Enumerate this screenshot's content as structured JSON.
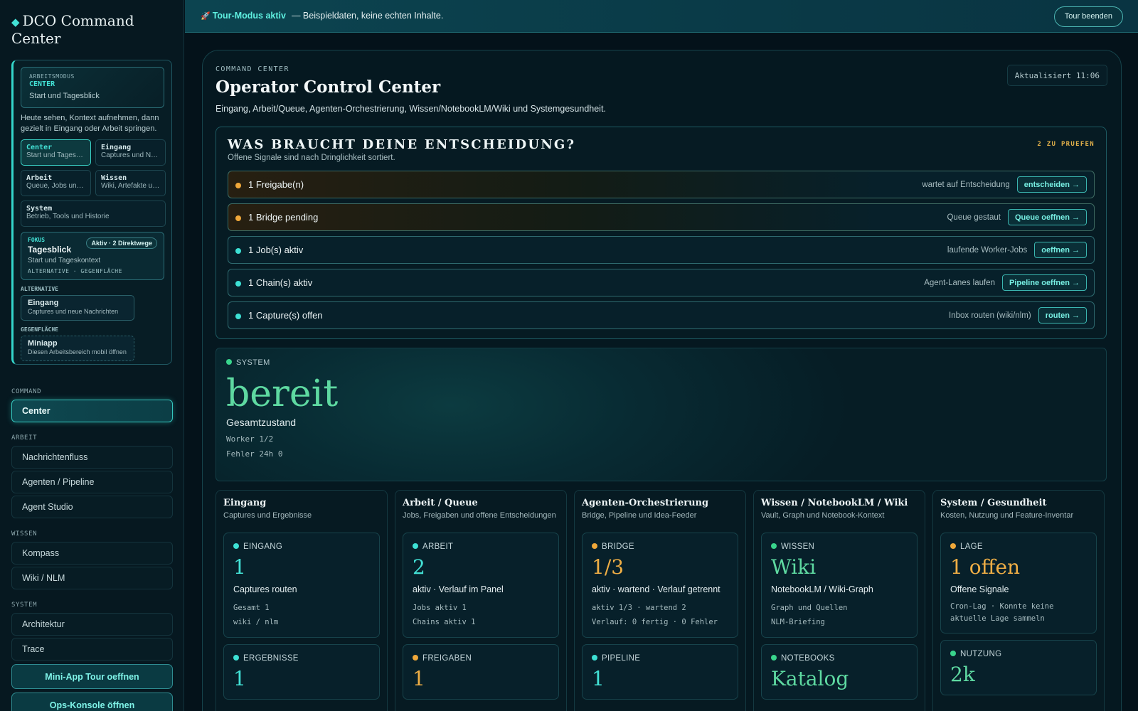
{
  "sidebar": {
    "brand": "DCO Command Center",
    "mode": {
      "label": "ARBEITSMODUS",
      "title": "CENTER",
      "subtitle": "Start und Tagesblick",
      "description": "Heute sehen, Kontext aufnehmen, dann gezielt in Eingang oder Arbeit springen.",
      "tiles": [
        {
          "title": "Center",
          "sub": "Start und Tagesblick"
        },
        {
          "title": "Eingang",
          "sub": "Captures und Nachrichten"
        },
        {
          "title": "Arbeit",
          "sub": "Queue, Jobs und Freigaben"
        },
        {
          "title": "Wissen",
          "sub": "Wiki, Artefakte und Notebooks"
        },
        {
          "title": "System",
          "sub": "Betrieb, Tools und Historie"
        }
      ],
      "focus": {
        "label": "FOKUS",
        "title": "Tagesblick",
        "sub": "Start und Tageskontext",
        "badge": "Aktiv · 2 Direktwege",
        "alt": "ALTERNATIVE · GEGENFLÄCHE"
      },
      "alternative_label": "ALTERNATIVE",
      "alternative": {
        "title": "Eingang",
        "sub": "Captures und neue Nachrichten"
      },
      "counter_label": "GEGENFLÄCHE",
      "counter": {
        "title": "Miniapp",
        "sub": "Diesen Arbeitsbereich mobil öffnen"
      }
    },
    "nav": [
      {
        "section": "COMMAND",
        "items": [
          "Center"
        ]
      },
      {
        "section": "ARBEIT",
        "items": [
          "Nachrichtenfluss",
          "Agenten / Pipeline",
          "Agent Studio"
        ]
      },
      {
        "section": "WISSEN",
        "items": [
          "Kompass",
          "Wiki / NLM"
        ]
      },
      {
        "section": "SYSTEM",
        "items": [
          "Architektur",
          "Trace"
        ]
      }
    ],
    "cta_primary": "Mini-App Tour oeffnen",
    "cta_secondary": "Ops-Konsole öffnen"
  },
  "banner": {
    "icon": "rocket-icon",
    "active": "Tour-Modus aktiv",
    "rest": "— Beispieldaten, keine echten Inhalte.",
    "end_button": "Tour beenden"
  },
  "main": {
    "eyebrow": "COMMAND CENTER",
    "title": "Operator Control Center",
    "subtitle": "Eingang, Arbeit/Queue, Agenten-Orchestrierung, Wissen/NotebookLM/Wiki und Systemgesundheit.",
    "updated": "Aktualisiert 11:06"
  },
  "decision": {
    "title": "WAS BRAUCHT DEINE ENTSCHEIDUNG?",
    "subtitle": "Offene Signale sind nach Dringlichkeit sortiert.",
    "count": "2 ZU PRUEFEN",
    "rows": [
      {
        "label": "1 Freigabe(n)",
        "hint": "wartet auf Entscheidung",
        "button": "entscheiden →",
        "level": "warn"
      },
      {
        "label": "1 Bridge pending",
        "hint": "Queue gestaut",
        "button": "Queue oeffnen →",
        "level": "warn"
      },
      {
        "label": "1 Job(s) aktiv",
        "hint": "laufende Worker-Jobs",
        "button": "oeffnen →",
        "level": "ok"
      },
      {
        "label": "1 Chain(s) aktiv",
        "hint": "Agent-Lanes laufen",
        "button": "Pipeline oeffnen →",
        "level": "ok"
      },
      {
        "label": "1 Capture(s) offen",
        "hint": "Inbox routen (wiki/nlm)",
        "button": "routen →",
        "level": "ok"
      }
    ]
  },
  "system": {
    "label": "SYSTEM",
    "value": "bereit",
    "caption": "Gesamtzustand",
    "lines": [
      "Worker 1/2",
      "Fehler 24h 0"
    ]
  },
  "columns": [
    {
      "title": "Eingang",
      "sub": "Captures und Ergebnisse",
      "tiles": [
        {
          "label": "EINGANG",
          "dot": "teal",
          "value": "1",
          "caption": "Captures routen",
          "meta": [
            "Gesamt 1",
            "wiki / nlm"
          ]
        },
        {
          "label": "ERGEBNISSE",
          "dot": "teal",
          "value": "1",
          "caption": "",
          "meta": []
        }
      ]
    },
    {
      "title": "Arbeit / Queue",
      "sub": "Jobs, Freigaben und offene Entscheidungen",
      "tiles": [
        {
          "label": "ARBEIT",
          "dot": "teal",
          "value": "2",
          "caption": "aktiv · Verlauf im Panel",
          "meta": [
            "Jobs aktiv 1",
            "Chains aktiv 1"
          ]
        },
        {
          "label": "FREIGABEN",
          "dot": "orange",
          "value": "1",
          "caption": "",
          "meta": []
        }
      ]
    },
    {
      "title": "Agenten-Orchestrierung",
      "sub": "Bridge, Pipeline und Idea-Feeder",
      "tiles": [
        {
          "label": "BRIDGE",
          "dot": "orange",
          "value": "1/3",
          "caption": "aktiv · wartend · Verlauf getrennt",
          "meta": [
            "aktiv 1/3 · wartend 2",
            "Verlauf: 0 fertig · 0 Fehler"
          ]
        },
        {
          "label": "PIPELINE",
          "dot": "teal",
          "value": "1",
          "caption": "",
          "meta": []
        }
      ]
    },
    {
      "title": "Wissen / NotebookLM / Wiki",
      "sub": "Vault, Graph und Notebook-Kontext",
      "tiles": [
        {
          "label": "WISSEN",
          "dot": "green",
          "value": "Wiki",
          "caption": "NotebookLM / Wiki-Graph",
          "meta": [
            "Graph und Quellen",
            "NLM-Briefing"
          ]
        },
        {
          "label": "NOTEBOOKS",
          "dot": "green",
          "value": "Katalog",
          "caption": "",
          "meta": []
        }
      ]
    },
    {
      "title": "System / Gesundheit",
      "sub": "Kosten, Nutzung und Feature-Inventar",
      "tiles": [
        {
          "label": "LAGE",
          "dot": "orange",
          "value": "1 offen",
          "caption": "Offene Signale",
          "meta": [
            "Cron-Lag · Konnte keine aktuelle Lage sammeln"
          ]
        },
        {
          "label": "NUTZUNG",
          "dot": "green",
          "value": "2k",
          "caption": "",
          "meta": []
        }
      ]
    }
  ]
}
